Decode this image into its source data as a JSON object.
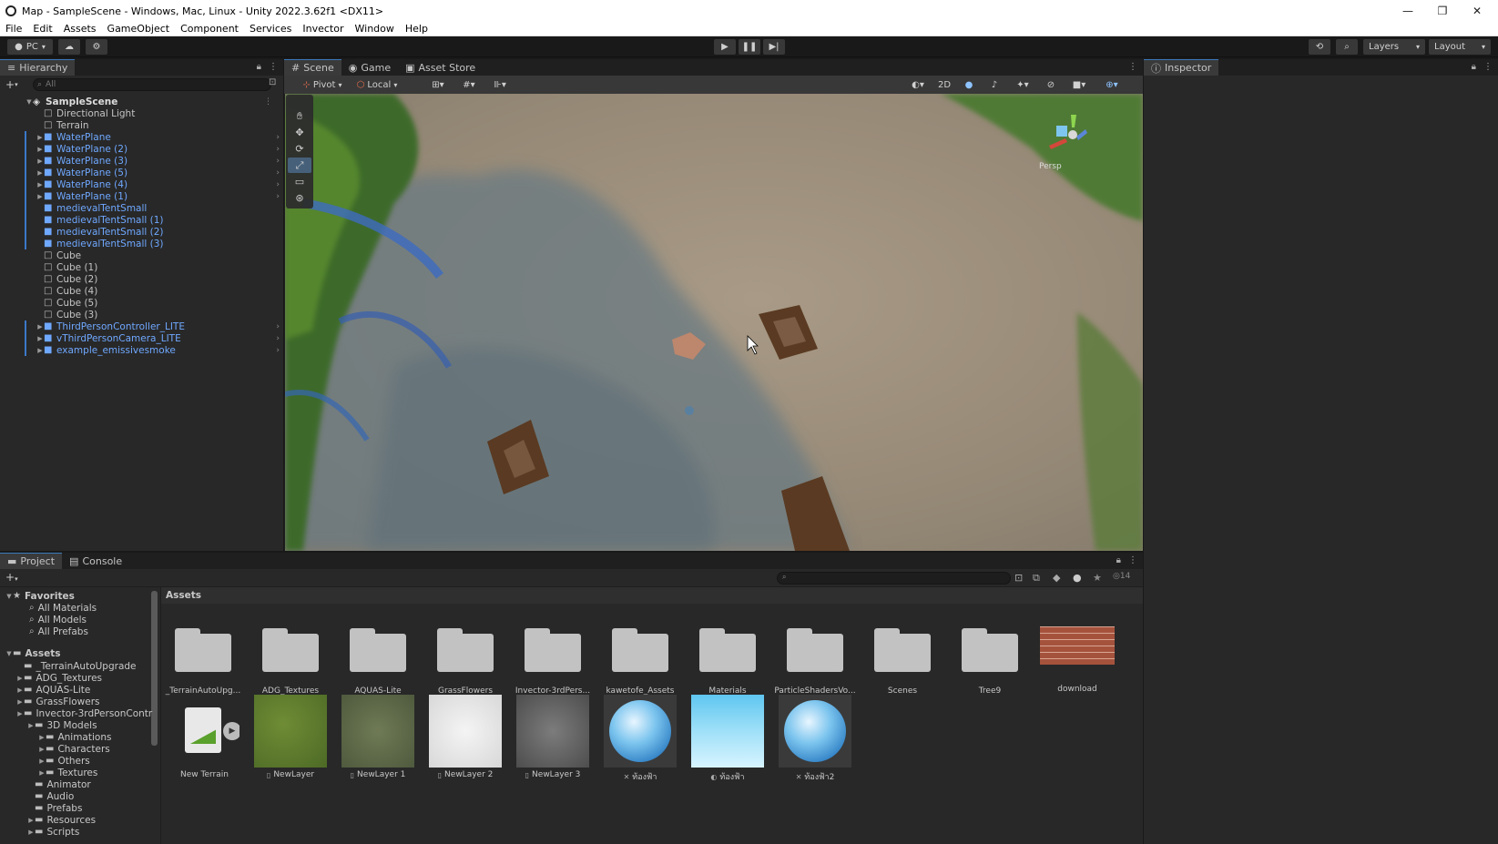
{
  "window": {
    "title": "Map - SampleScene - Windows, Mac, Linux - Unity 2022.3.62f1 <DX11>",
    "controls": [
      "—",
      "❐",
      "✕"
    ]
  },
  "menu": [
    "File",
    "Edit",
    "Assets",
    "GameObject",
    "Component",
    "Services",
    "Invector",
    "Window",
    "Help"
  ],
  "toolbar": {
    "platform": "PC",
    "layers": "Layers",
    "layout": "Layout"
  },
  "hierarchy": {
    "tab": "Hierarchy",
    "search_placeholder": "All",
    "scene": "SampleScene",
    "items": [
      {
        "label": "Directional Light",
        "prefab": false,
        "expand": false
      },
      {
        "label": "Terrain",
        "prefab": false,
        "expand": false
      },
      {
        "label": "WaterPlane",
        "prefab": true,
        "expand": true
      },
      {
        "label": "WaterPlane (2)",
        "prefab": true,
        "expand": true
      },
      {
        "label": "WaterPlane (3)",
        "prefab": true,
        "expand": true
      },
      {
        "label": "WaterPlane (5)",
        "prefab": true,
        "expand": true
      },
      {
        "label": "WaterPlane (4)",
        "prefab": true,
        "expand": true
      },
      {
        "label": "WaterPlane (1)",
        "prefab": true,
        "expand": true
      },
      {
        "label": "medievalTentSmall",
        "prefab": true,
        "expand": false
      },
      {
        "label": "medievalTentSmall (1)",
        "prefab": true,
        "expand": false
      },
      {
        "label": "medievalTentSmall (2)",
        "prefab": true,
        "expand": false
      },
      {
        "label": "medievalTentSmall (3)",
        "prefab": true,
        "expand": false
      },
      {
        "label": "Cube",
        "prefab": false,
        "expand": false
      },
      {
        "label": "Cube (1)",
        "prefab": false,
        "expand": false
      },
      {
        "label": "Cube (2)",
        "prefab": false,
        "expand": false
      },
      {
        "label": "Cube (4)",
        "prefab": false,
        "expand": false
      },
      {
        "label": "Cube (5)",
        "prefab": false,
        "expand": false
      },
      {
        "label": "Cube (3)",
        "prefab": false,
        "expand": false
      },
      {
        "label": "ThirdPersonController_LITE",
        "prefab": true,
        "expand": true
      },
      {
        "label": "vThirdPersonCamera_LITE",
        "prefab": true,
        "expand": true
      },
      {
        "label": "example_emissivesmoke",
        "prefab": true,
        "expand": true
      }
    ]
  },
  "scene_view": {
    "tabs": [
      "Scene",
      "Game",
      "Asset Store"
    ],
    "pivot": "Pivot",
    "local": "Local",
    "mode_2d": "2D",
    "persp": "Persp"
  },
  "inspector": {
    "tab": "Inspector"
  },
  "project": {
    "tabs": [
      "Project",
      "Console"
    ],
    "hidden_count": "14",
    "favorites": {
      "title": "Favorites",
      "items": [
        "All Materials",
        "All Models",
        "All Prefabs"
      ]
    },
    "assets_title": "Assets",
    "tree": [
      {
        "label": "_TerrainAutoUpgrade",
        "depth": 1,
        "expand": false
      },
      {
        "label": "ADG_Textures",
        "depth": 1,
        "expand": true
      },
      {
        "label": "AQUAS-Lite",
        "depth": 1,
        "expand": true
      },
      {
        "label": "GrassFlowers",
        "depth": 1,
        "expand": true
      },
      {
        "label": "Invector-3rdPersonContr",
        "depth": 1,
        "expand": true
      },
      {
        "label": "3D Models",
        "depth": 2,
        "expand": true
      },
      {
        "label": "Animations",
        "depth": 3,
        "expand": true
      },
      {
        "label": "Characters",
        "depth": 3,
        "expand": true
      },
      {
        "label": "Others",
        "depth": 3,
        "expand": true
      },
      {
        "label": "Textures",
        "depth": 3,
        "expand": true
      },
      {
        "label": "Animator",
        "depth": 2,
        "expand": false
      },
      {
        "label": "Audio",
        "depth": 2,
        "expand": false
      },
      {
        "label": "Prefabs",
        "depth": 2,
        "expand": false
      },
      {
        "label": "Resources",
        "depth": 2,
        "expand": true
      },
      {
        "label": "Scripts",
        "depth": 2,
        "expand": true
      }
    ],
    "breadcrumb": "Assets",
    "folders": [
      "_TerrainAutoUpg...",
      "ADG_Textures",
      "AQUAS-Lite",
      "GrassFlowers",
      "Invector-3rdPers...",
      "kawetofe_Assets",
      "Materials",
      "ParticleShadersVo...",
      "Scenes",
      "Tree9"
    ],
    "download_label": "download",
    "row2": [
      {
        "label": "New Terrain",
        "kind": "terrain"
      },
      {
        "label": "NewLayer",
        "kind": "grass"
      },
      {
        "label": "NewLayer 1",
        "kind": "rock"
      },
      {
        "label": "NewLayer 2",
        "kind": "snow"
      },
      {
        "label": "NewLayer 3",
        "kind": "gravel"
      },
      {
        "label": "ท้องฟ้า",
        "kind": "skysphere"
      },
      {
        "label": "ท้องฟ้า",
        "kind": "skytex"
      },
      {
        "label": "ท้องฟ้า2",
        "kind": "skysphere"
      }
    ]
  },
  "colors": {
    "prefab": "#6fa8ff",
    "accent": "#3a79bb",
    "panel": "#282828"
  }
}
